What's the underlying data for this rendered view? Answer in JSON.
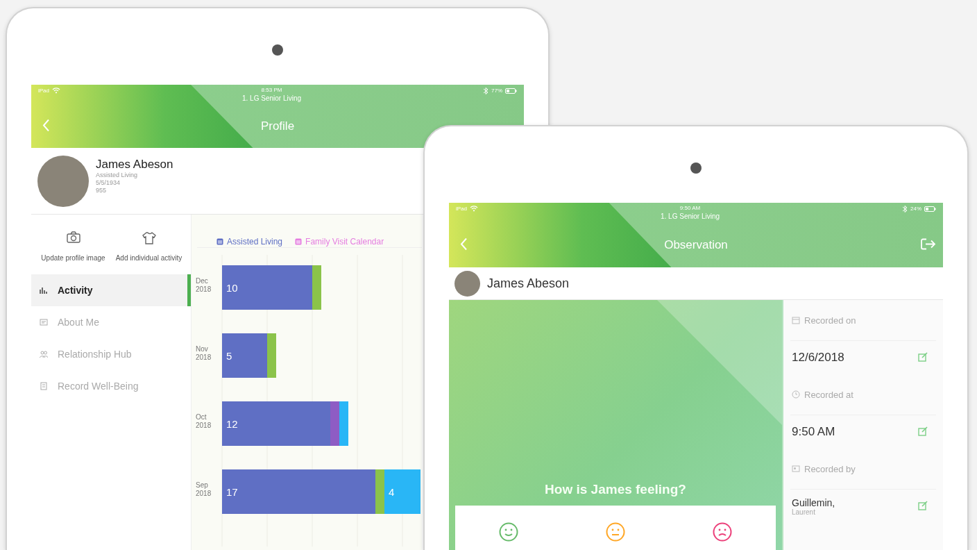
{
  "profile_tablet": {
    "status_bar": {
      "carrier": "iPad",
      "time": "8:53 PM",
      "battery": "77%"
    },
    "header": {
      "subtitle": "1. LG Senior Living",
      "title": "Profile",
      "exit_button": false
    },
    "resident": {
      "name": "James Abeson",
      "details": [
        "Assisted Living",
        "5/5/1934",
        "955"
      ]
    },
    "actions": [
      {
        "kind": "camera",
        "label": "Update profile image"
      },
      {
        "kind": "shirt",
        "label": "Add individual activity"
      }
    ],
    "nav": [
      {
        "kind": "chart",
        "label": "Activity",
        "selected": true
      },
      {
        "kind": "card",
        "label": "About Me",
        "selected": false
      },
      {
        "kind": "people",
        "label": "Relationship Hub",
        "selected": false
      },
      {
        "kind": "form",
        "label": "Record Well-Being",
        "selected": false
      }
    ],
    "chart_data": {
      "type": "bar",
      "orientation": "horizontal",
      "stacked": true,
      "categories": [
        "Dec 2018",
        "Nov 2018",
        "Oct 2018",
        "Sep 2018"
      ],
      "series": [
        {
          "name": "Assisted Living",
          "color": "#5f6fc4",
          "values": [
            10,
            5,
            12,
            17
          ],
          "value_labels": [
            "10",
            "5",
            "12",
            "17"
          ]
        },
        {
          "name": "Family Visit Calendar",
          "color": "#e57ee0",
          "values": [
            null,
            null,
            null,
            null
          ]
        },
        {
          "color": "#8bc34a",
          "values": [
            1,
            1,
            null,
            1
          ]
        },
        {
          "color": "#8e5cc4",
          "values": [
            null,
            null,
            1,
            null
          ]
        },
        {
          "color": "#29b6f6",
          "values": [
            null,
            null,
            1,
            4
          ],
          "value_labels": [
            null,
            null,
            null,
            "4"
          ]
        }
      ]
    }
  },
  "observation_tablet": {
    "status_bar": {
      "carrier": "iPad",
      "time": "9:50 AM",
      "battery": "24%"
    },
    "header": {
      "subtitle": "1. LG Senior Living",
      "title": "Observation",
      "exit_button": true
    },
    "resident": {
      "name": "James Abeson"
    },
    "question": "How is James feeling?",
    "moods": [
      {
        "kind": "happy",
        "color": "#66bb6a"
      },
      {
        "kind": "neutral",
        "color": "#ffa726"
      },
      {
        "kind": "sad",
        "color": "#ec407a"
      }
    ],
    "fields": [
      {
        "kind": "date",
        "label": "Recorded on",
        "value": "12/6/2018"
      },
      {
        "kind": "time",
        "label": "Recorded at",
        "value": "9:50 AM"
      },
      {
        "kind": "person",
        "label": "Recorded by",
        "value": "Guillemin,",
        "subvalue": "Laurent"
      }
    ]
  }
}
